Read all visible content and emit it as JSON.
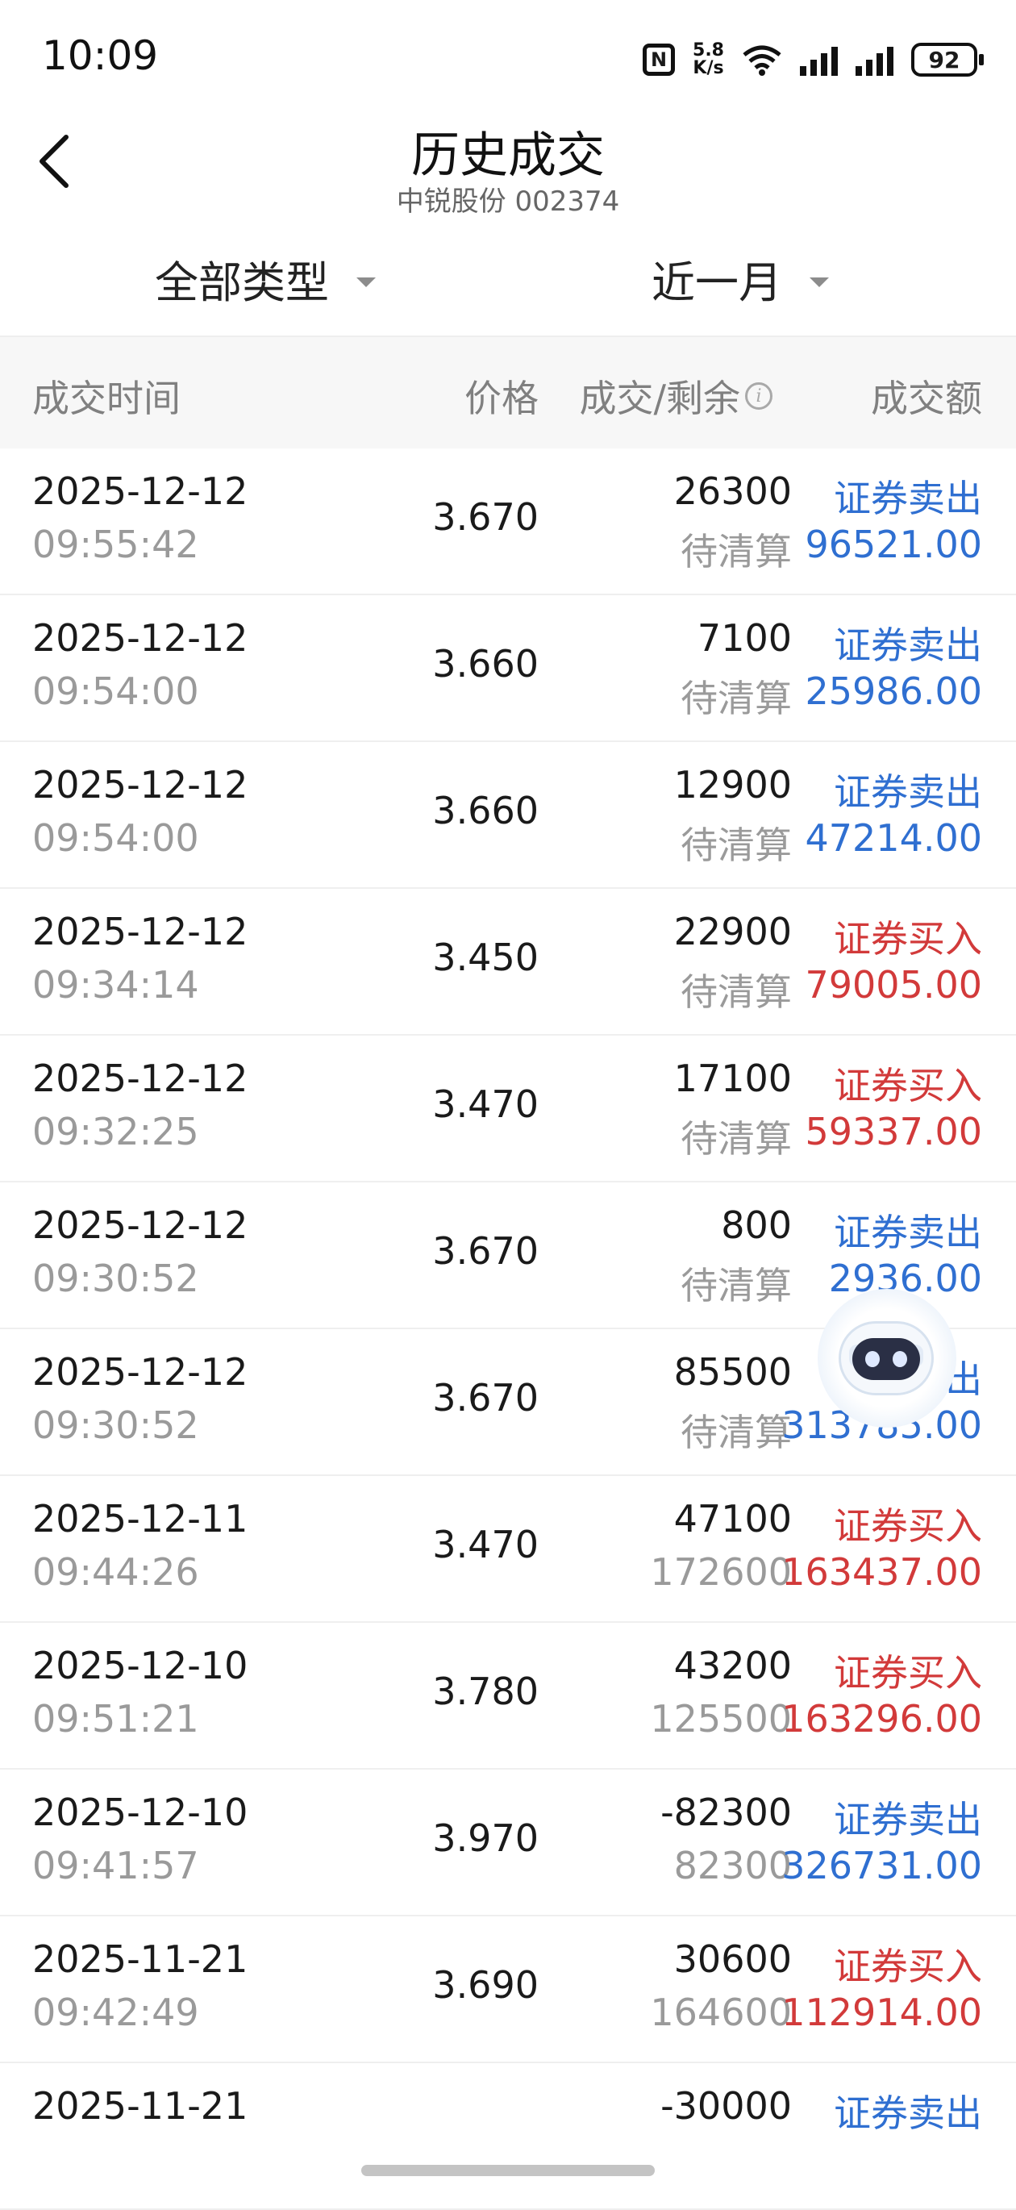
{
  "status_bar": {
    "time": "10:09",
    "net_speed_value": "5.8",
    "net_speed_unit": "K/s",
    "battery": "92"
  },
  "header": {
    "title": "历史成交",
    "subtitle": "中锐股份 002374"
  },
  "filters": {
    "type": "全部类型",
    "period": "近一月"
  },
  "table": {
    "headers": {
      "time": "成交时间",
      "price": "价格",
      "fill": "成交/剩余",
      "amount": "成交额"
    },
    "rows": [
      {
        "date": "2025-12-12",
        "time": "09:55:42",
        "price": "3.670",
        "qty": "26300",
        "remain": "待清算",
        "type": "证券卖出",
        "amount": "96521.00",
        "side": "sell"
      },
      {
        "date": "2025-12-12",
        "time": "09:54:00",
        "price": "3.660",
        "qty": "7100",
        "remain": "待清算",
        "type": "证券卖出",
        "amount": "25986.00",
        "side": "sell"
      },
      {
        "date": "2025-12-12",
        "time": "09:54:00",
        "price": "3.660",
        "qty": "12900",
        "remain": "待清算",
        "type": "证券卖出",
        "amount": "47214.00",
        "side": "sell"
      },
      {
        "date": "2025-12-12",
        "time": "09:34:14",
        "price": "3.450",
        "qty": "22900",
        "remain": "待清算",
        "type": "证券买入",
        "amount": "79005.00",
        "side": "buy"
      },
      {
        "date": "2025-12-12",
        "time": "09:32:25",
        "price": "3.470",
        "qty": "17100",
        "remain": "待清算",
        "type": "证券买入",
        "amount": "59337.00",
        "side": "buy"
      },
      {
        "date": "2025-12-12",
        "time": "09:30:52",
        "price": "3.670",
        "qty": "800",
        "remain": "待清算",
        "type": "证券卖出",
        "amount": "2936.00",
        "side": "sell"
      },
      {
        "date": "2025-12-12",
        "time": "09:30:52",
        "price": "3.670",
        "qty": "85500",
        "remain": "待清算",
        "type": "证券卖出",
        "amount": "313785.00",
        "side": "sell"
      },
      {
        "date": "2025-12-11",
        "time": "09:44:26",
        "price": "3.470",
        "qty": "47100",
        "remain": "172600",
        "type": "证券买入",
        "amount": "163437.00",
        "side": "buy"
      },
      {
        "date": "2025-12-10",
        "time": "09:51:21",
        "price": "3.780",
        "qty": "43200",
        "remain": "125500",
        "type": "证券买入",
        "amount": "163296.00",
        "side": "buy"
      },
      {
        "date": "2025-12-10",
        "time": "09:41:57",
        "price": "3.970",
        "qty": "-82300",
        "remain": "82300",
        "type": "证券卖出",
        "amount": "326731.00",
        "side": "sell"
      },
      {
        "date": "2025-11-21",
        "time": "09:42:49",
        "price": "3.690",
        "qty": "30600",
        "remain": "164600",
        "type": "证券买入",
        "amount": "112914.00",
        "side": "buy"
      },
      {
        "date": "2025-11-21",
        "time": "",
        "price": "",
        "qty": "-30000",
        "remain": "",
        "type": "证券卖出",
        "amount": "",
        "side": "sell"
      }
    ]
  },
  "colors": {
    "sell": "#2f6fd1",
    "buy": "#d23a3a"
  }
}
